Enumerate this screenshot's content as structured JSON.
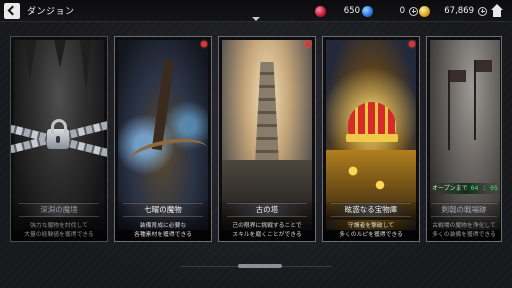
{
  "header": {
    "title": "ダンジョン",
    "resources": [
      {
        "name": "red-gem",
        "value": "650",
        "color": "#c4173a"
      },
      {
        "name": "blue-gem",
        "value": "0",
        "color": "#2a74e0"
      },
      {
        "name": "gold-coin",
        "value": "67,869",
        "color": "#d9a320"
      }
    ]
  },
  "cards": [
    {
      "title": "深淵の魔境",
      "desc_line1": "強力な魔物を討伐して",
      "desc_line2": "大量の経験値を獲得できる",
      "state": "locked",
      "icon": "lock-icon"
    },
    {
      "title": "七曜の魔物",
      "desc_line1": "装備育成に必要な",
      "desc_line2": "各種素材を獲得できる",
      "state": "available",
      "new": true
    },
    {
      "title": "古の塔",
      "desc_line1": "己の限界に挑戦することで",
      "desc_line2": "スキルを磨くことができる",
      "state": "available",
      "new": true
    },
    {
      "title": "眩惑なる宝物庫",
      "desc_line1": "守護者を撃破して",
      "desc_line2": "多くのルピを獲得できる",
      "state": "available",
      "new": true
    },
    {
      "title": "剣戟の戦場跡",
      "desc_line1": "古戦場の魔物を浄化して",
      "desc_line2": "多くの装備を獲得できる",
      "state": "upcoming",
      "timer_label": "オープンまで",
      "timer_value": "04 : 05"
    }
  ]
}
